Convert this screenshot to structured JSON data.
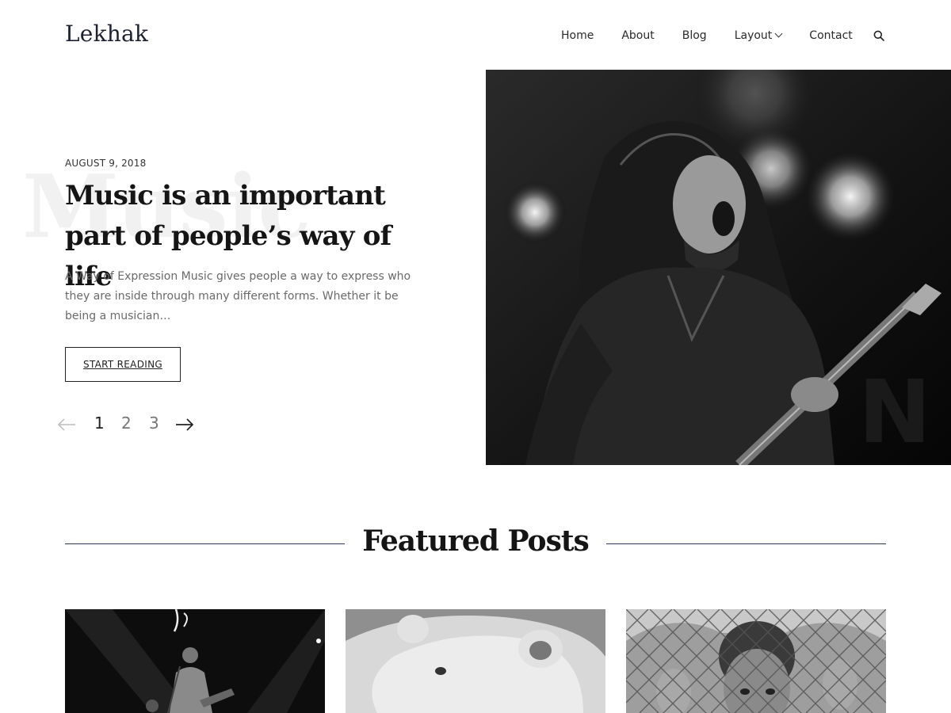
{
  "site": {
    "logo": "Lekhak"
  },
  "nav": {
    "items": [
      {
        "label": "Home"
      },
      {
        "label": "About"
      },
      {
        "label": "Blog"
      },
      {
        "label": "Layout"
      },
      {
        "label": "Contact"
      }
    ],
    "search_icon": "search-icon"
  },
  "hero": {
    "ghost_word": "Music",
    "date": "AUGUST 9, 2018",
    "title": "Music is an important part of people’s way of life",
    "excerpt": "A Way of Expression Music gives people a way to express who they are inside through many different forms. Whether it be being a musician…",
    "button_label": "START READING",
    "pagination": {
      "pages": [
        "1",
        "2",
        "3"
      ],
      "current": "1"
    }
  },
  "featured": {
    "heading": "Featured Posts"
  },
  "colors": {
    "accent_line": "#2c3652",
    "text_dark": "#151515"
  }
}
